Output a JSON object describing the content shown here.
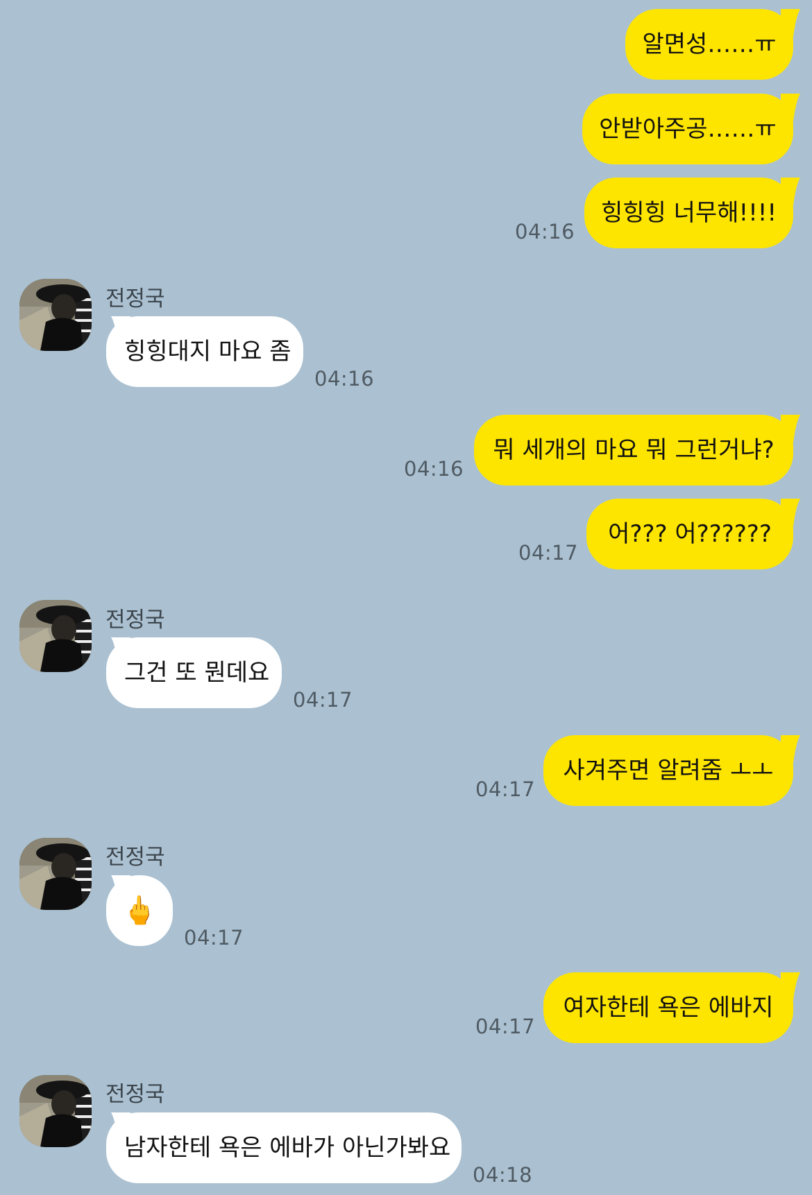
{
  "contact": {
    "name": "전정국"
  },
  "colors": {
    "background": "#abc1d1",
    "my_bubble": "#fee500",
    "their_bubble": "#ffffff"
  },
  "messages": [
    {
      "from": "me",
      "text": "알면성……ㅠ",
      "time": ""
    },
    {
      "from": "me",
      "text": "안받아주공……ㅠ",
      "time": ""
    },
    {
      "from": "me",
      "text": "힝힝힝 너무해!!!!",
      "time": "04:16"
    },
    {
      "from": "them",
      "sender": "전정국",
      "text": "힝힝대지 마요 좀",
      "time": "04:16"
    },
    {
      "from": "me",
      "text": "뭐 세개의 마요 뭐 그런거냐?",
      "time": "04:16"
    },
    {
      "from": "me",
      "text": "어??? 어??????",
      "time": "04:17"
    },
    {
      "from": "them",
      "sender": "전정국",
      "text": "그건 또 뭔데요",
      "time": "04:17"
    },
    {
      "from": "me",
      "text": "사겨주면 알려줌 ㅗㅗ",
      "time": "04:17"
    },
    {
      "from": "them",
      "sender": "전정국",
      "text": "🖕",
      "time": "04:17",
      "is_emoji": true
    },
    {
      "from": "me",
      "text": "여자한테 욕은 에바지",
      "time": "04:17"
    },
    {
      "from": "them",
      "sender": "전정국",
      "text": "남자한테 욕은 에바가 아닌가봐요",
      "time": "04:18"
    }
  ]
}
